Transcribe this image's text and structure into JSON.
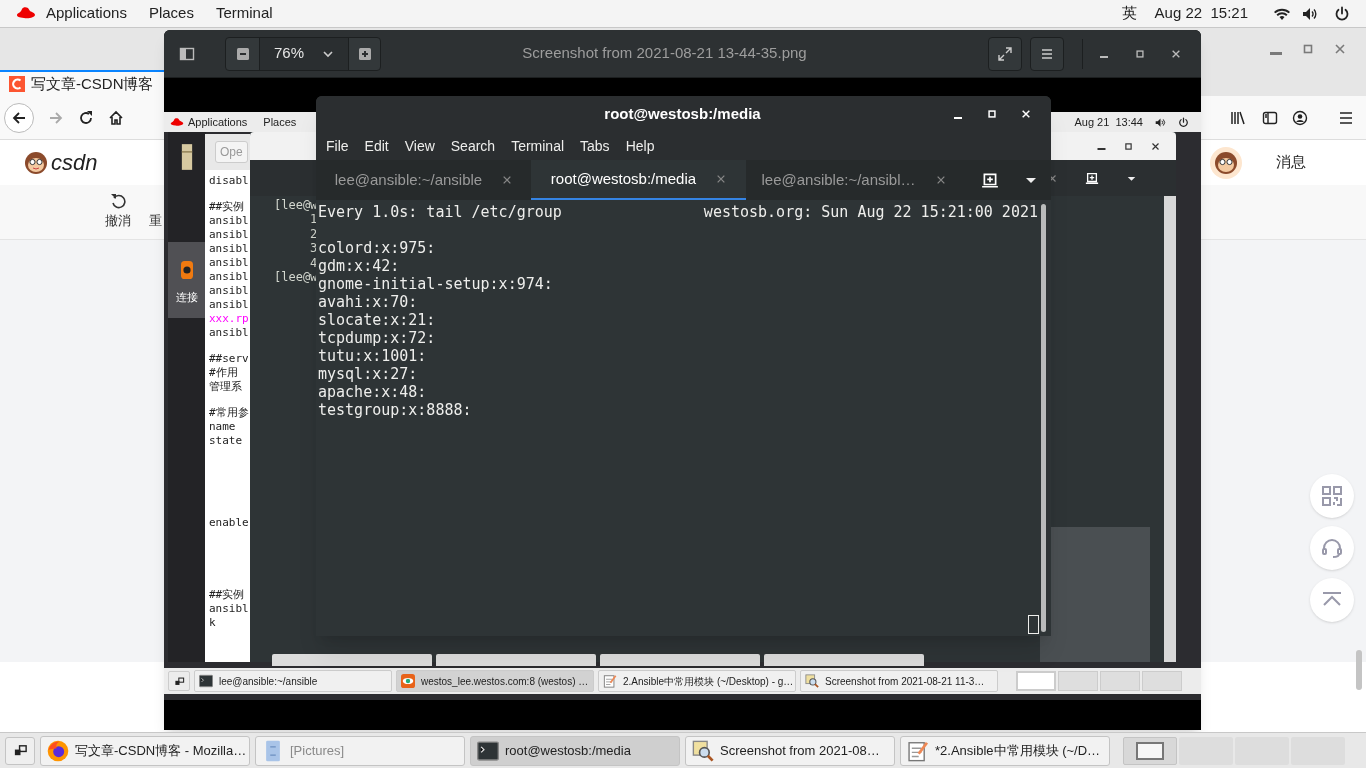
{
  "top_bar": {
    "menus": [
      "Applications",
      "Places",
      "Terminal"
    ],
    "input_method": "英",
    "clock": "Aug 22  15:21"
  },
  "browser": {
    "tab_title": "写文章-CSDN博客",
    "logo_text": "csdn",
    "editor_toolbar": [
      "撤消",
      "重"
    ],
    "messages": "消息"
  },
  "image_viewer": {
    "zoom": "76%",
    "title": "Screenshot from 2021-08-21 13-44-35.png",
    "screenshot": {
      "top_bar": {
        "menus": [
          "Applications",
          "Places"
        ],
        "clock": "Aug 21  13:44"
      },
      "dock_label": "连接",
      "editor": {
        "button": "Ope",
        "paragraphs": [
          [
            {
              "text": "disabl",
              "highlight": false
            }
          ],
          [
            {
              "text": "##实例",
              "highlight": false
            },
            {
              "text": "ansibl",
              "highlight": false
            },
            {
              "text": "ansibl",
              "highlight": false
            },
            {
              "text": "ansibl",
              "highlight": false
            },
            {
              "text": "ansibl",
              "highlight": false
            },
            {
              "text": "ansibl",
              "highlight": false
            },
            {
              "text": "ansibl",
              "highlight": false
            },
            {
              "text": "ansibl",
              "highlight": false
            },
            {
              "text": "xxx.rp",
              "highlight": true
            },
            {
              "text": "ansibl",
              "highlight": false
            }
          ],
          [
            {
              "text": "##serv",
              "highlight": false
            },
            {
              "text": "#作用",
              "highlight": false
            },
            {
              "text": "管理系",
              "highlight": false
            }
          ],
          [
            {
              "text": "#常用参",
              "highlight": false
            },
            {
              "text": "name",
              "highlight": false
            },
            {
              "text": "state",
              "highlight": false
            }
          ],
          [
            {
              "text": "enable",
              "highlight": false
            }
          ],
          [
            {
              "text": "##实例",
              "highlight": false
            },
            {
              "text": "ansibl",
              "highlight": false
            },
            {
              "text": "k",
              "highlight": false
            }
          ]
        ]
      },
      "terminal_lines": [
        "[lee@w",
        "     1",
        "     2",
        "     3",
        "     4",
        "[lee@w"
      ],
      "taskbar": [
        {
          "label": "lee@ansible:~/ansible",
          "selected": false,
          "kind": "terminal"
        },
        {
          "label": "westos_lee.westos.com:8 (westos) …",
          "selected": true,
          "kind": "remote"
        },
        {
          "label": "2.Ansible中常用模块 (~/Desktop) - g…",
          "selected": false,
          "kind": "editor"
        },
        {
          "label": "Screenshot from 2021-08-21 11-3…",
          "selected": false,
          "kind": "viewer"
        }
      ],
      "workspaces": [
        {
          "selected": true
        },
        {
          "selected": false
        },
        {
          "selected": false
        },
        {
          "selected": false
        }
      ]
    }
  },
  "terminal": {
    "title": "root@westosb:/media",
    "menu": [
      "File",
      "Edit",
      "View",
      "Search",
      "Terminal",
      "Tabs",
      "Help"
    ],
    "tabs": [
      {
        "label": "lee@ansible:~/ansible",
        "selected": false
      },
      {
        "label": "root@westosb:/media",
        "selected": true
      },
      {
        "label": "lee@ansible:~/ansibl…",
        "selected": false
      }
    ],
    "watch_header": {
      "command": "Every 1.0s: tail /etc/group",
      "host_time": "westosb.org: Sun Aug 22 15:21:00 2021"
    },
    "lines": [
      "colord:x:975:",
      "gdm:x:42:",
      "gnome-initial-setup:x:974:",
      "avahi:x:70:",
      "slocate:x:21:",
      "tcpdump:x:72:",
      "tutu:x:1001:",
      "mysql:x:27:",
      "apache:x:48:",
      "testgroup:x:8888:"
    ]
  },
  "taskbar": {
    "items": [
      {
        "label": "写文章-CSDN博客 - Mozilla…",
        "selected": false,
        "minimized": false,
        "kind": "browser"
      },
      {
        "label": "[Pictures]",
        "selected": false,
        "minimized": true,
        "kind": "files"
      },
      {
        "label": "root@westosb:/media",
        "selected": true,
        "minimized": false,
        "kind": "terminal"
      },
      {
        "label": "Screenshot from 2021-08…",
        "selected": false,
        "minimized": false,
        "kind": "viewer"
      },
      {
        "label": "*2.Ansible中常用模块 (~/D…",
        "selected": false,
        "minimized": false,
        "kind": "editor"
      }
    ],
    "workspaces": [
      {
        "selected": true
      },
      {
        "selected": false
      },
      {
        "selected": false
      },
      {
        "selected": false
      }
    ]
  }
}
